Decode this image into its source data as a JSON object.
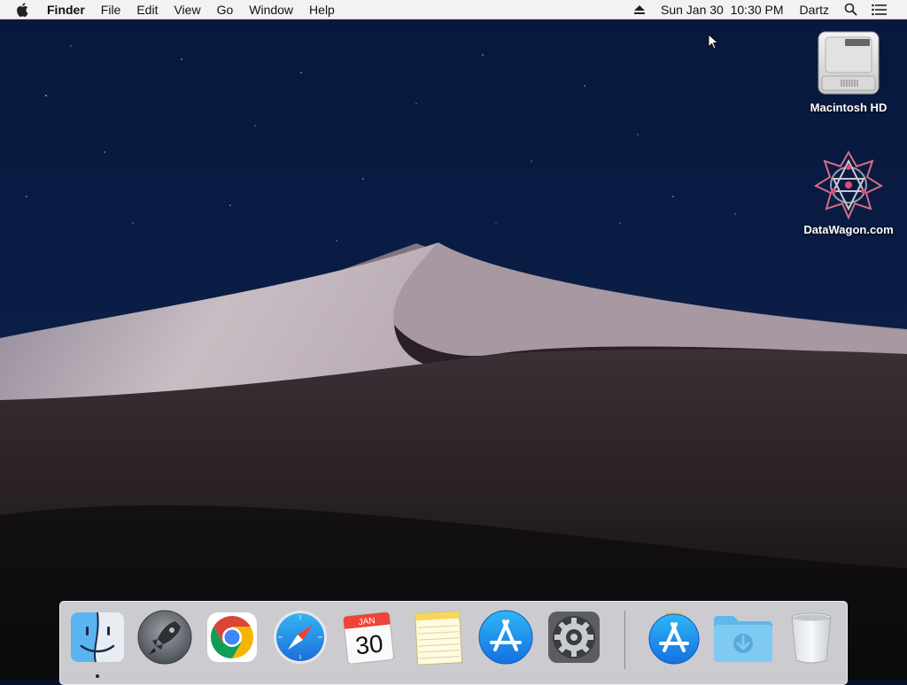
{
  "menubar": {
    "app_name": "Finder",
    "menus": [
      "File",
      "Edit",
      "View",
      "Go",
      "Window",
      "Help"
    ],
    "clock": "Sun Jan 30  10:30 PM",
    "user": "Dartz",
    "icons": [
      "apple-icon",
      "eject-icon",
      "spotlight-search-icon",
      "notification-center-icon"
    ]
  },
  "desktop_icons": [
    {
      "label": "Macintosh HD",
      "icon": "hard-drive-icon"
    },
    {
      "label": "DataWagon.com",
      "icon": "datawagon-logo-icon"
    }
  ],
  "dock": {
    "items": [
      {
        "name": "Finder",
        "icon": "finder-icon",
        "running": true
      },
      {
        "name": "Launchpad",
        "icon": "launchpad-icon"
      },
      {
        "name": "Google Chrome",
        "icon": "chrome-icon"
      },
      {
        "name": "Safari",
        "icon": "safari-icon"
      },
      {
        "name": "Calendar",
        "icon": "calendar-icon",
        "month": "JAN",
        "day": "30"
      },
      {
        "name": "Notes",
        "icon": "notes-icon"
      },
      {
        "name": "App Store",
        "icon": "app-store-icon"
      },
      {
        "name": "System Preferences",
        "icon": "system-preferences-icon"
      },
      {
        "name": "App Store Installer",
        "icon": "app-store-installer-icon"
      },
      {
        "name": "Downloads",
        "icon": "downloads-folder-icon"
      },
      {
        "name": "Trash",
        "icon": "trash-icon"
      }
    ]
  },
  "colors": {
    "sky": "#0a1d45",
    "dune_light": "#b8acb6",
    "dune_dark": "#141216",
    "menubar_bg": "#f2f2f2",
    "dock_bg": "#dcdce1"
  }
}
